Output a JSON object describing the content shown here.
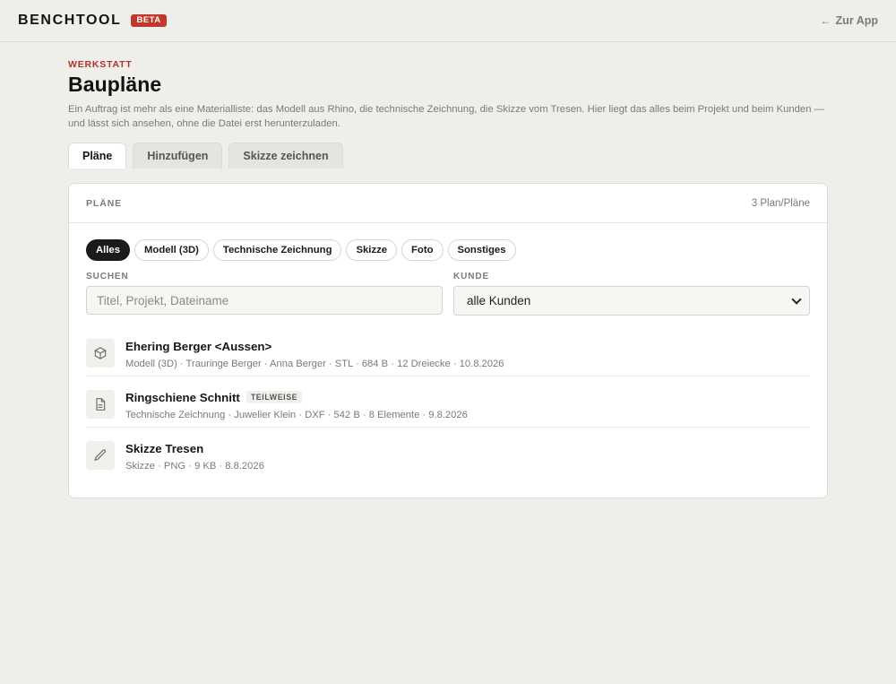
{
  "header": {
    "brand": "BENCHTOOL",
    "badge": "BETA",
    "back_arrow": "←",
    "back_label": "Zur App"
  },
  "page": {
    "eyebrow": "WERKSTATT",
    "title": "Baupläne",
    "description": "Ein Auftrag ist mehr als eine Materialliste: das Modell aus Rhino, die technische Zeichnung, die Skizze vom Tresen. Hier liegt das alles beim Projekt und beim Kunden — und lässt sich ansehen, ohne die Datei erst herunterzuladen."
  },
  "tabs": [
    {
      "label": "Pläne",
      "active": true
    },
    {
      "label": "Hinzufügen",
      "active": false
    },
    {
      "label": "Skizze zeichnen",
      "active": false
    }
  ],
  "panel": {
    "title": "PLÄNE",
    "count": "3 Plan/Pläne",
    "chips": [
      {
        "label": "Alles",
        "active": true
      },
      {
        "label": "Modell (3D)",
        "active": false
      },
      {
        "label": "Technische Zeichnung",
        "active": false
      },
      {
        "label": "Skizze",
        "active": false
      },
      {
        "label": "Foto",
        "active": false
      },
      {
        "label": "Sonstiges",
        "active": false
      }
    ],
    "search": {
      "label": "SUCHEN",
      "value": "",
      "placeholder": "Titel, Projekt, Dateiname"
    },
    "customer": {
      "label": "KUNDE",
      "value": "alle Kunden"
    }
  },
  "plans": [
    {
      "icon": "cube-icon",
      "title": "Ehering Berger <Aussen>",
      "tag": "",
      "meta": "Modell (3D) · Trauringe Berger · Anna Berger · STL · 684 B · 12 Dreiecke · 10.8.2026"
    },
    {
      "icon": "document-icon",
      "title": "Ringschiene Schnitt",
      "tag": "TEILWEISE",
      "meta": "Technische Zeichnung · Juwelier Klein · DXF · 542 B · 8 Elemente · 9.8.2026"
    },
    {
      "icon": "pencil-icon",
      "title": "Skizze Tresen",
      "tag": "",
      "meta": "Skizze · PNG · 9 KB · 8.8.2026"
    }
  ],
  "colors": {
    "accent": "#b23327",
    "badge": "#c0392b",
    "background": "#efeeea",
    "chip_active": "#1b1b1b"
  }
}
